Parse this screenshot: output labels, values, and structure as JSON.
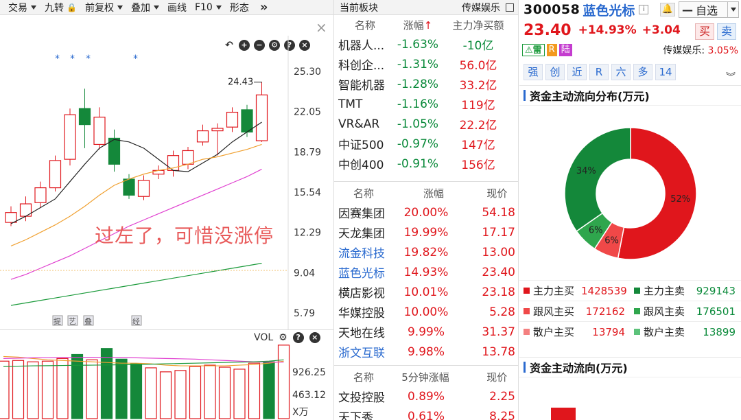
{
  "toolbar": {
    "items": [
      {
        "label": "交易",
        "caret": true
      },
      {
        "label": "九转",
        "lock": true
      },
      {
        "label": "前复权",
        "caret": true
      },
      {
        "label": "叠加",
        "caret": true
      },
      {
        "label": "画线",
        "caret": false
      },
      {
        "label": "F10",
        "caret": true
      },
      {
        "label": "形态",
        "caret": false
      }
    ],
    "more_icon": "»"
  },
  "kline": {
    "price_axis": [
      "25.30",
      "22.05",
      "18.79",
      "15.54",
      "12.29",
      "9.04",
      "5.79"
    ],
    "high_label": "24.43",
    "annotation": "过左了，可惜没涨停",
    "marker_labels": [
      "提",
      "艺",
      "叠",
      "经"
    ],
    "candles": [
      {
        "o": 13.1,
        "c": 13.9,
        "h": 14.4,
        "l": 12.8
      },
      {
        "o": 13.6,
        "c": 14.6,
        "h": 15.2,
        "l": 13.2
      },
      {
        "o": 14.7,
        "c": 15.9,
        "h": 16.4,
        "l": 14.3
      },
      {
        "o": 15.9,
        "c": 18.1,
        "h": 18.5,
        "l": 15.6
      },
      {
        "o": 18.2,
        "c": 21.8,
        "h": 22.3,
        "l": 17.7
      },
      {
        "o": 22.3,
        "c": 21.0,
        "h": 23.9,
        "l": 19.1
      },
      {
        "o": 19.4,
        "c": 21.6,
        "h": 22.4,
        "l": 19.0
      },
      {
        "o": 19.9,
        "c": 17.8,
        "h": 20.6,
        "l": 17.2
      },
      {
        "o": 16.6,
        "c": 15.3,
        "h": 17.0,
        "l": 15.0
      },
      {
        "o": 15.2,
        "c": 16.5,
        "h": 16.9,
        "l": 14.9
      },
      {
        "o": 17.0,
        "c": 17.3,
        "h": 17.7,
        "l": 16.6
      },
      {
        "o": 17.3,
        "c": 18.5,
        "h": 18.9,
        "l": 16.8
      },
      {
        "o": 17.8,
        "c": 18.9,
        "h": 19.2,
        "l": 17.4
      },
      {
        "o": 19.6,
        "c": 20.5,
        "h": 21.0,
        "l": 19.3
      },
      {
        "o": 20.5,
        "c": 20.7,
        "h": 21.1,
        "l": 18.5
      },
      {
        "o": 20.8,
        "c": 22.0,
        "h": 22.4,
        "l": 20.4
      },
      {
        "o": 22.2,
        "c": 20.4,
        "h": 22.6,
        "l": 20.0
      },
      {
        "o": 19.7,
        "c": 23.4,
        "h": 24.43,
        "l": 19.6
      }
    ],
    "ma5": [
      13.0,
      13.6,
      14.3,
      15.0,
      16.4,
      17.8,
      19.1,
      19.8,
      19.6,
      19.1,
      18.2,
      17.3,
      17.2,
      17.9,
      18.6,
      19.6,
      20.4,
      21.2
    ],
    "ma10": [
      11.2,
      11.7,
      12.3,
      12.9,
      13.6,
      14.4,
      15.3,
      16.1,
      16.6,
      17.0,
      17.3,
      17.5,
      17.8,
      18.2,
      18.4,
      18.7,
      19.0,
      19.4
    ],
    "ma20": [
      8.5,
      8.9,
      9.4,
      9.9,
      10.4,
      11.0,
      11.6,
      12.2,
      12.8,
      13.3,
      13.8,
      14.3,
      14.8,
      15.3,
      15.8,
      16.3,
      16.8,
      17.4
    ],
    "ma60": [
      6.4,
      6.6,
      6.8,
      7.0,
      7.2,
      7.4,
      7.6,
      7.8,
      8.0,
      8.2,
      8.4,
      8.6,
      8.8,
      9.0,
      9.2,
      9.4,
      9.6,
      9.8
    ]
  },
  "volume": {
    "label": "VOL",
    "axis": [
      "926.25",
      "463.12",
      "X万"
    ],
    "values": [
      860,
      870,
      850,
      860,
      900,
      960,
      880,
      1050,
      890,
      820,
      760,
      700,
      720,
      780,
      800,
      770,
      740,
      830,
      850,
      1100
    ],
    "up": [
      true,
      true,
      true,
      true,
      true,
      false,
      true,
      false,
      false,
      false,
      true,
      true,
      true,
      true,
      true,
      true,
      true,
      true,
      false,
      true
    ]
  },
  "sector_panel": {
    "title": "当前板块",
    "sector_name": "传媒娱乐",
    "headers": {
      "name": "名称",
      "chg": "涨幅",
      "chg_arrow": "↑",
      "net": "主力净买额"
    },
    "rows": [
      {
        "name": "机器人...",
        "chg": "-1.63%",
        "net": "-10亿",
        "net_color": "green"
      },
      {
        "name": "科创企...",
        "chg": "-1.31%",
        "net": "56.0亿",
        "net_color": "red"
      },
      {
        "name": "智能机器",
        "chg": "-1.28%",
        "net": "33.2亿",
        "net_color": "red"
      },
      {
        "name": "TMT",
        "chg": "-1.16%",
        "net": "119亿",
        "net_color": "red"
      },
      {
        "name": "VR&AR",
        "chg": "-1.05%",
        "net": "22.2亿",
        "net_color": "red"
      },
      {
        "name": "中证500",
        "chg": "-0.97%",
        "net": "147亿",
        "net_color": "red"
      },
      {
        "name": "中创400",
        "chg": "-0.91%",
        "net": "156亿",
        "net_color": "red"
      }
    ]
  },
  "stocks_panel": {
    "headers": {
      "name": "名称",
      "chg": "涨幅",
      "price": "现价"
    },
    "rows": [
      {
        "name": "因赛集团",
        "chg": "20.00%",
        "price": "54.18",
        "name_color": "black"
      },
      {
        "name": "天龙集团",
        "chg": "19.99%",
        "price": "17.17",
        "name_color": "black"
      },
      {
        "name": "流金科技",
        "chg": "19.82%",
        "price": "13.00",
        "name_color": "blue"
      },
      {
        "name": "蓝色光标",
        "chg": "14.93%",
        "price": "23.40",
        "name_color": "blue"
      },
      {
        "name": "横店影视",
        "chg": "10.01%",
        "price": "23.18",
        "name_color": "black"
      },
      {
        "name": "华媒控股",
        "chg": "10.00%",
        "price": "5.28",
        "name_color": "black"
      },
      {
        "name": "天地在线",
        "chg": "9.99%",
        "price": "31.37",
        "name_color": "black"
      },
      {
        "name": "浙文互联",
        "chg": "9.98%",
        "price": "13.78",
        "name_color": "blue"
      }
    ]
  },
  "speed_panel": {
    "headers": {
      "name": "名称",
      "chg": "5分钟涨幅",
      "price": "现价"
    },
    "rows": [
      {
        "name": "文投控股",
        "chg": "0.89%",
        "price": "2.25"
      },
      {
        "name": "天下秀",
        "chg": "0.61%",
        "price": "8.25"
      }
    ]
  },
  "quote": {
    "code": "300058",
    "name": "蓝色光标",
    "watch_label": "自选",
    "price": "23.40",
    "pct": "+14.93%",
    "change": "+3.04",
    "buy_label": "买",
    "sell_label": "卖",
    "tags": [
      "雷",
      "R",
      "陆"
    ],
    "sector": "传媒娱乐:",
    "sector_pct": "3.05%",
    "func_buttons": [
      "强",
      "创",
      "近",
      "R",
      "六",
      "多",
      "14"
    ]
  },
  "capital_dist": {
    "title": "资金主动流向分布(万元)",
    "slices": [
      {
        "label": "52%",
        "value": 52,
        "color": "#e0161c"
      },
      {
        "label": "6%",
        "value": 6,
        "color": "#f04848"
      },
      {
        "label": "6%",
        "value": 6,
        "color": "#2fa64d"
      },
      {
        "label": "34%",
        "value": 34,
        "color": "#14883a"
      }
    ],
    "rows": [
      {
        "a_label": "主力主买",
        "a_val": "1428539",
        "a_color": "#e0161c",
        "b_label": "主力主卖",
        "b_val": "929143",
        "b_color": "#14883a"
      },
      {
        "a_label": "跟风主买",
        "a_val": "172162",
        "a_color": "#f04848",
        "b_label": "跟风主卖",
        "b_val": "176501",
        "b_color": "#2fa64d"
      },
      {
        "a_label": "散户主买",
        "a_val": "13794",
        "a_color": "#f48080",
        "b_label": "散户主卖",
        "b_val": "13899",
        "b_color": "#5cc27a"
      }
    ]
  },
  "capital_flow": {
    "title": "资金主动流向(万元)"
  }
}
